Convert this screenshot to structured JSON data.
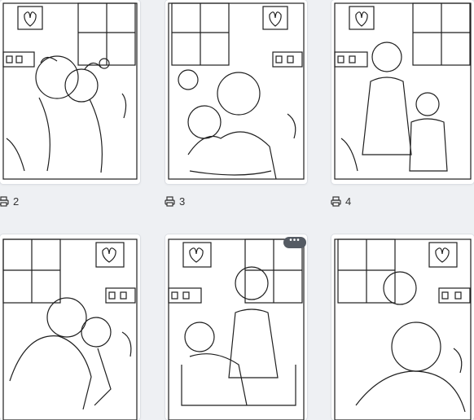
{
  "page_labels": [
    "2",
    "3",
    "4"
  ],
  "more_button": {
    "glyph": "•••"
  },
  "icons": {
    "page_icon": "printer-icon",
    "more_icon": "ellipsis-icon"
  },
  "colors": {
    "background": "#eef0f3",
    "card": "#ffffff",
    "line": "#1f1f1f",
    "more_button": "#555b63"
  }
}
